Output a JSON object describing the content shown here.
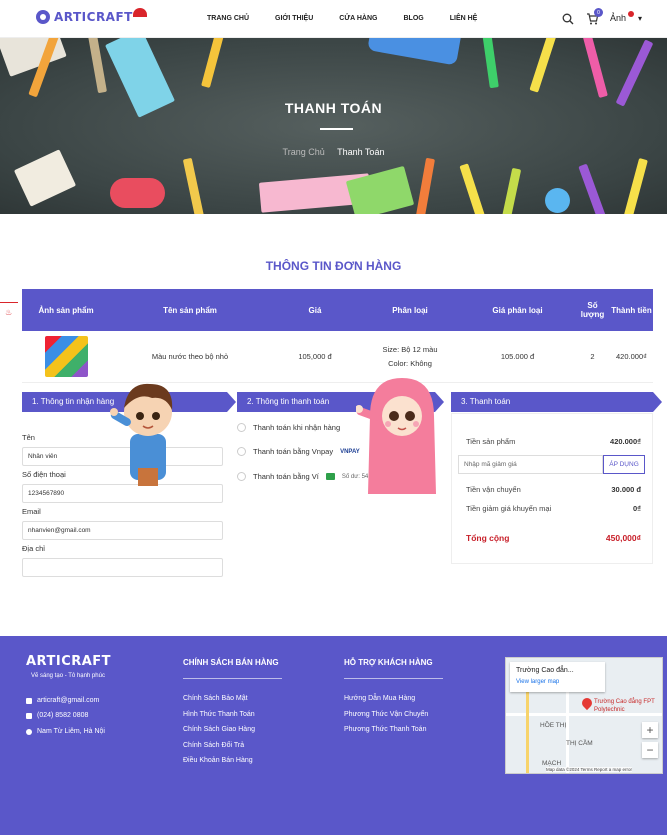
{
  "header": {
    "logo_text": "ARTICRAFT",
    "nav": [
      "TRANG CHỦ",
      "GIỚI THIỆU",
      "CỬA HÀNG",
      "BLOG",
      "LIÊN HỆ"
    ],
    "cart_count": "0",
    "avatar_alt": "Ảnh"
  },
  "hero": {
    "title": "THANH TOÁN",
    "breadcrumb_home": "Trang Chủ",
    "breadcrumb_current": "Thanh Toán"
  },
  "order": {
    "section_title": "THÔNG TIN ĐƠN HÀNG",
    "columns": [
      "Ảnh sản phẩm",
      "Tên sản phẩm",
      "Giá",
      "Phân loại",
      "Giá phân loại",
      "Số lượng",
      "Thành tiền"
    ],
    "rows": [
      {
        "name": "Màu nước theo bộ nhỏ",
        "price": "105,000 đ",
        "variant_size": "Size: Bộ 12 màu",
        "variant_color": "Color: Không",
        "variant_price": "105.000 đ",
        "qty": "2",
        "subtotal": "420.000₫"
      }
    ]
  },
  "receiver": {
    "header": "1. Thông tin nhận hàng",
    "name_label": "Tên",
    "name_value": "Nhân viên",
    "phone_label": "Số điện thoại",
    "phone_value": "1234567890",
    "email_label": "Email",
    "email_value": "nhanvien@gmail.com",
    "address_label": "Địa chỉ",
    "address_value": ""
  },
  "payment": {
    "header": "2. Thông tin thanh toán",
    "options": [
      "Thanh toán khi nhận hàng",
      "Thanh toán bằng Vnpay",
      "Thanh toán bằng Ví"
    ],
    "vnpay_logo": "VNPAY",
    "wallet_balance": "Số dư: 548.000"
  },
  "summary": {
    "header": "3. Thanh toán",
    "subtotal_label": "Tiền sản phẩm",
    "subtotal_value": "420.000₫",
    "coupon_placeholder": "Nhập mã giảm giá",
    "apply_label": "ÁP DỤNG",
    "shipping_label": "Tiền vận chuyển",
    "shipping_value": "30.000 đ",
    "discount_label": "Tiền giảm giá khuyến mại",
    "discount_value": "0₫",
    "total_label": "Tổng cộng",
    "total_value": "450,000₫"
  },
  "footer": {
    "logo": "ARTICRAFT",
    "tagline": "Vẽ sáng tạo - Tô hạnh phúc",
    "email": "articraft@gmail.com",
    "phone": "(024) 8582 0808",
    "address": "Nam Từ Liêm, Hà Nội",
    "policy_title": "CHÍNH SÁCH BÁN HÀNG",
    "policy_links": [
      "Chính Sách Bảo Mật",
      "Hình Thức Thanh Toán",
      "Chính Sách Giao Hàng",
      "Chính Sách Đổi Trả",
      "Điều Khoản Bán Hàng"
    ],
    "support_title": "HỖ TRỢ KHÁCH HÀNG",
    "support_links": [
      "Hướng Dẫn Mua Hàng",
      "Phương Thức Vận Chuyển",
      "Phương Thức Thanh Toán"
    ],
    "map": {
      "place_title": "Trường Cao đẳn...",
      "view_larger": "View larger map",
      "pin_label": "Trường Cao đẳng FPT Polytechnic",
      "area1": "HỒE THỊ",
      "area2": "THỊ CẦM",
      "area3": "MẠCH",
      "attribution": "Map data ©2024   Terms   Report a map error"
    }
  },
  "colors": {
    "primary": "#5a57c9",
    "total": "#c8202a"
  }
}
